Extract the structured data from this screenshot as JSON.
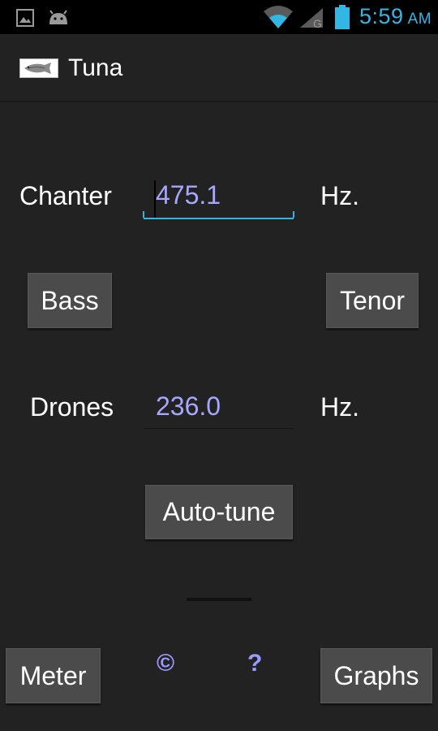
{
  "status_bar": {
    "time": "5:59",
    "ampm": "AM",
    "icons": [
      "picture-icon",
      "android-icon",
      "wifi-icon",
      "signal-icon",
      "battery-icon"
    ],
    "accent_color": "#33b5e5"
  },
  "action_bar": {
    "title": "Tuna",
    "logo": "tuna-fish-icon"
  },
  "chanter": {
    "label": "Chanter",
    "value": "475.1",
    "unit": "Hz."
  },
  "buttons": {
    "bass": "Bass",
    "tenor": "Tenor",
    "autotune": "Auto-tune",
    "meter": "Meter",
    "graphs": "Graphs"
  },
  "drones": {
    "label": "Drones",
    "value": "236.0",
    "unit": "Hz."
  },
  "footer": {
    "copyright": "©",
    "help": "?"
  },
  "colors": {
    "background": "#222222",
    "field_text": "#a7a7ff",
    "link_text": "#9a9aff",
    "button_bg": "#4b4b4b"
  }
}
